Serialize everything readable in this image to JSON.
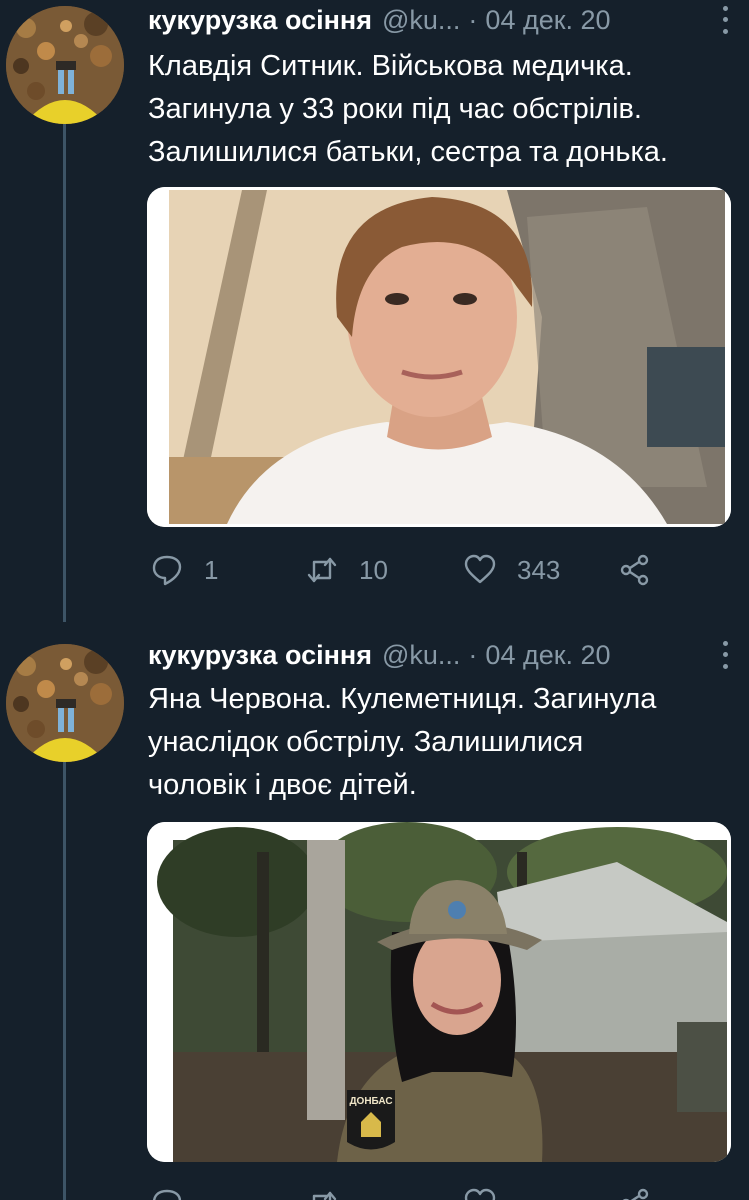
{
  "tweets": [
    {
      "author_name": "кукурузка осіння",
      "author_handle": "@ku...",
      "separator": "·",
      "date": "04 дек. 20",
      "text": "Клавдія Ситник. Військова медичка.\nЗагинула у 33 роки під час обстрілів.\nЗалишилися батьки, сестра та донька.",
      "replies": "1",
      "retweets": "10",
      "likes": "343",
      "icons": {
        "reply": "reply-icon",
        "retweet": "retweet-icon",
        "like": "heart-icon",
        "share": "share-icon"
      }
    },
    {
      "author_name": "кукурузка осіння",
      "author_handle": "@ku...",
      "separator": "·",
      "date": "04 дек. 20",
      "text": "Яна Червона. Кулеметниця. Загинула\nунаслідок обстрілу. Залишилися\nчоловік і двоє дітей.",
      "patch_text": "ДОНБАС",
      "icons": {
        "reply": "reply-icon",
        "retweet": "retweet-icon",
        "like": "heart-icon",
        "share": "share-icon"
      }
    }
  ],
  "colors": {
    "background": "#15202b",
    "text": "#ffffff",
    "secondary": "#8899a6",
    "thread_line": "#3d5466"
  }
}
